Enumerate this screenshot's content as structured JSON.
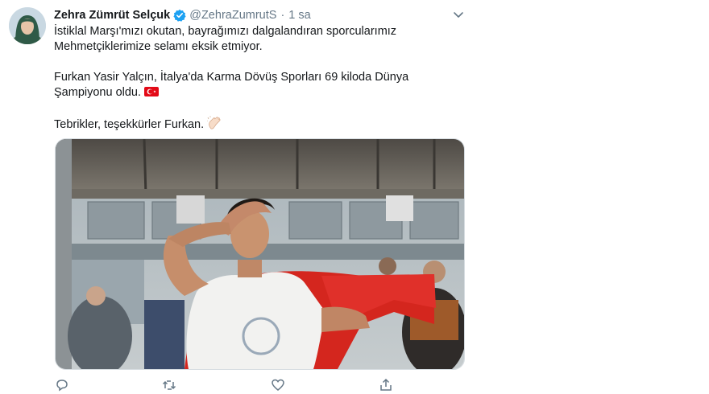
{
  "tweet": {
    "author_name": "Zehra Zümrüt Selçuk",
    "handle": "@ZehraZumrutS",
    "separator": "·",
    "time": "1 sa",
    "paragraphs": [
      "İstiklal Marşı'mızı okutan, bayrağımızı dalgalandıran sporcularımız Mehmetçiklerimize selamı eksik etmiyor.",
      "Furkan Yasir Yalçın, İtalya'da Karma Dövüş Sporları 69 kiloda Dünya Şampiyonu oldu.",
      "Tebrikler, teşekkürler Furkan."
    ],
    "flag_emoji": "turkey-flag",
    "clap_emoji": "clapping-hands",
    "media": {
      "type": "video",
      "description_icon": "video-thumbnail"
    },
    "actions": {
      "reply": "",
      "retweet": "",
      "like": "",
      "share": ""
    }
  },
  "colors": {
    "text": "#14171a",
    "muted": "#657786",
    "verified": "#1da1f2",
    "flag_red": "#e30a17"
  }
}
